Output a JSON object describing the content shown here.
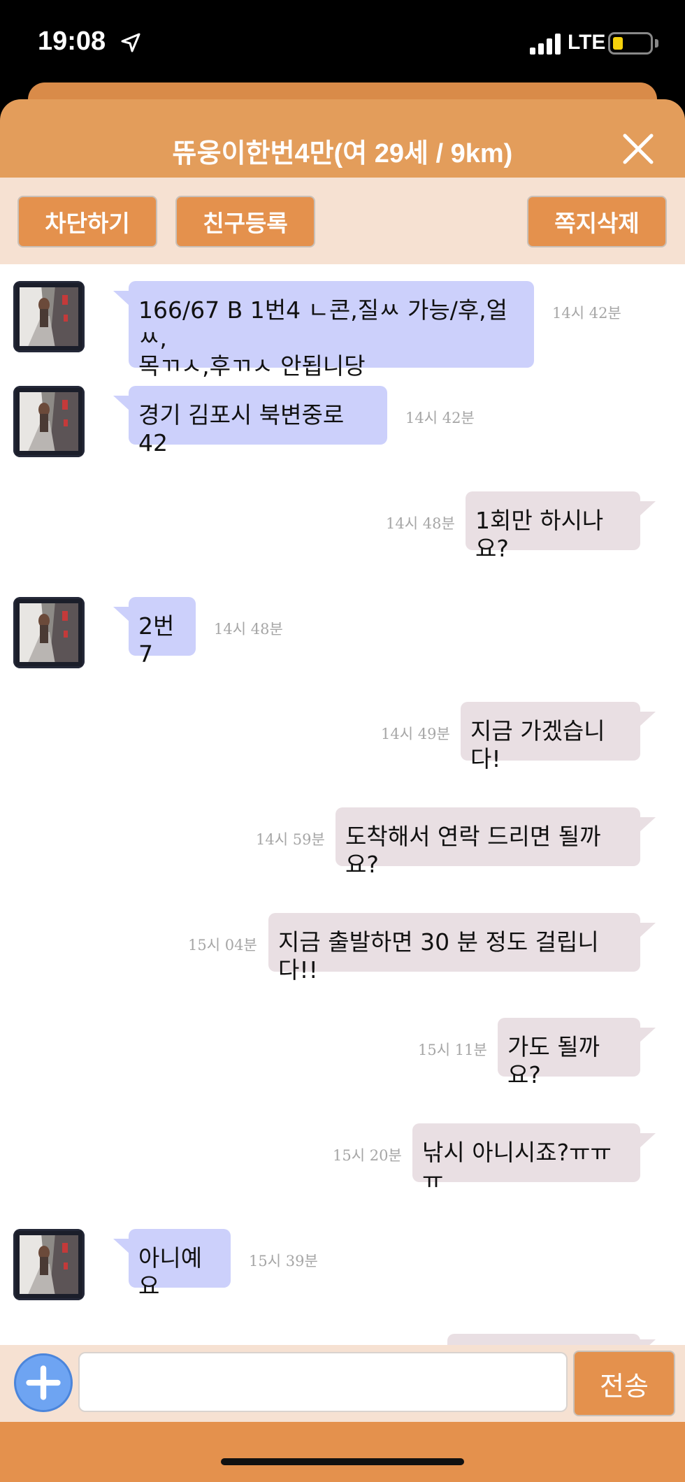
{
  "status_bar": {
    "time": "19:08",
    "network": "LTE"
  },
  "header": {
    "title": "뜌웅이한번4만(여  29세 / 9km)"
  },
  "actions": {
    "block": "차단하기",
    "add_friend": "친구등록",
    "delete_note": "쪽지삭제"
  },
  "messages": [
    {
      "side": "in",
      "lines": [
        "166/67 B 1번4 ㄴ콘,질ㅆ 가능/후,얼ㅆ,",
        "목ㄲㅅ,후ㄲㅅ 안됩니당"
      ],
      "time": "14시 42분"
    },
    {
      "side": "in",
      "lines": [
        "경기 김포시 북변중로 42"
      ],
      "time": "14시 42분"
    },
    {
      "side": "out",
      "lines": [
        "1회만 하시나요?"
      ],
      "time": "14시 48분"
    },
    {
      "side": "in",
      "lines": [
        "2번7"
      ],
      "time": "14시 48분"
    },
    {
      "side": "out",
      "lines": [
        "지금 가겠습니다!"
      ],
      "time": "14시 49분"
    },
    {
      "side": "out",
      "lines": [
        "도착해서 연락 드리면 될까요?"
      ],
      "time": "14시 59분"
    },
    {
      "side": "out",
      "lines": [
        "지금 출발하면 30 분 정도 걸립니다!!"
      ],
      "time": "15시 04분"
    },
    {
      "side": "out",
      "lines": [
        "가도 될까요?"
      ],
      "time": "15시 11분"
    },
    {
      "side": "out",
      "lines": [
        "낚시 아니시죠?ㅠㅠㅠ"
      ],
      "time": "15시 20분"
    },
    {
      "side": "in",
      "lines": [
        "아니예요"
      ],
      "time": "15시 39분"
    }
  ],
  "composer": {
    "placeholder": "",
    "send_label": "전송"
  },
  "colors": {
    "header": "#e39d5b",
    "incoming": "#ccd0fb",
    "outgoing": "#e9dfe3",
    "button": "#e4914d"
  }
}
